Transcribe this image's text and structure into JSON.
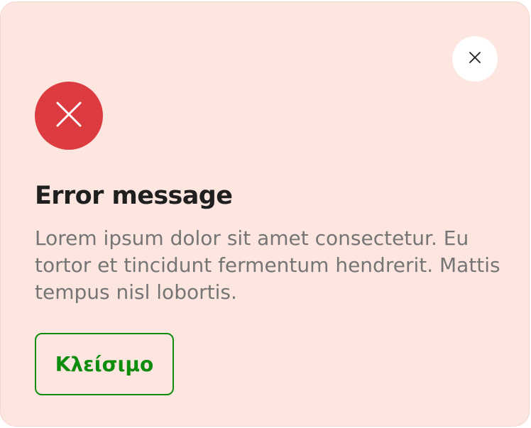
{
  "dialog": {
    "title": "Error message",
    "message": "Lorem ipsum dolor sit amet consectetur. Eu tortor et tincidunt fermentum hendrerit. Mattis tempus nisl lobortis.",
    "action_label": "Κλείσιμο",
    "close_icon": "close-icon",
    "status_icon": "error-x-icon"
  },
  "colors": {
    "background": "#fde6df",
    "error": "#dc3b3f",
    "accent": "#0e8c0e",
    "title": "#1f1f1f",
    "body_text": "#757575"
  }
}
